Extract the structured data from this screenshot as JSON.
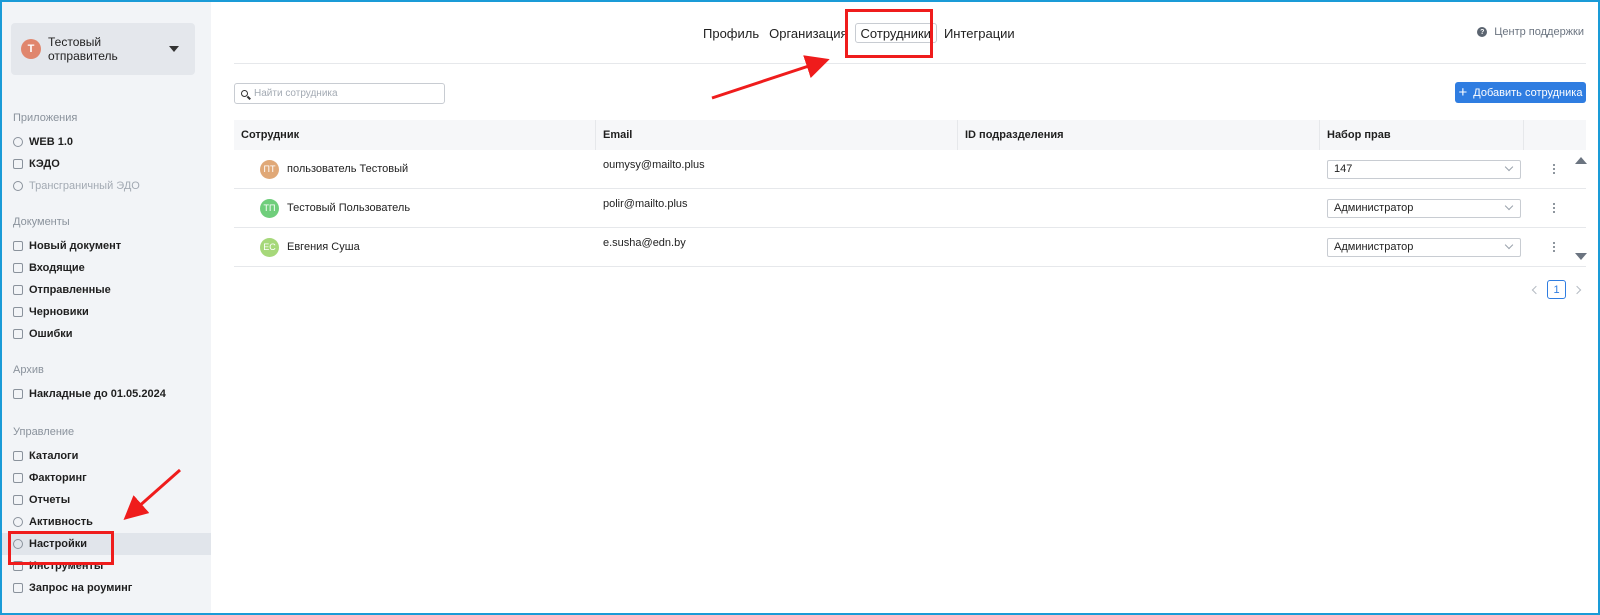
{
  "account": {
    "initial": "Т",
    "name": "Тестовый отправитель"
  },
  "sidebar": {
    "sections": [
      {
        "title": "Приложения",
        "items": [
          {
            "label": "WEB 1.0",
            "icon": "refresh-icon"
          },
          {
            "label": "КЭДО",
            "icon": "document-icon"
          },
          {
            "label": "Трансграничный ЭДО",
            "icon": "globe-icon",
            "disabled": true
          }
        ]
      },
      {
        "title": "Документы",
        "items": [
          {
            "label": "Новый документ",
            "icon": "new-document-icon"
          },
          {
            "label": "Входящие",
            "icon": "inbox-icon"
          },
          {
            "label": "Отправленные",
            "icon": "send-icon"
          },
          {
            "label": "Черновики",
            "icon": "draft-icon"
          },
          {
            "label": "Ошибки",
            "icon": "error-icon"
          }
        ]
      },
      {
        "title": "Архив",
        "items": [
          {
            "label": "Накладные до 01.05.2024",
            "icon": "archive-icon"
          }
        ]
      },
      {
        "title": "Управление",
        "items": [
          {
            "label": "Каталоги",
            "icon": "catalog-icon"
          },
          {
            "label": "Факторинг",
            "icon": "chart-icon"
          },
          {
            "label": "Отчеты",
            "icon": "report-icon"
          },
          {
            "label": "Активность",
            "icon": "activity-icon"
          },
          {
            "label": "Настройки",
            "icon": "gear-icon",
            "active": true
          },
          {
            "label": "Инструменты",
            "icon": "wrench-icon"
          },
          {
            "label": "Запрос на роуминг",
            "icon": "roaming-icon"
          }
        ]
      }
    ]
  },
  "tabs": [
    {
      "label": "Профиль"
    },
    {
      "label": "Организация"
    },
    {
      "label": "Сотрудники",
      "active": true
    },
    {
      "label": "Интеграции"
    }
  ],
  "help": {
    "label": "Центр поддержки"
  },
  "search": {
    "placeholder": "Найти сотрудника",
    "value": ""
  },
  "add_button": {
    "label": "Добавить сотрудника"
  },
  "table": {
    "columns": [
      "Сотрудник",
      "Email",
      "ID подразделения",
      "Набор прав"
    ],
    "rows": [
      {
        "initials": "ПТ",
        "avatar_color": "#e0a877",
        "name": "пользователь Тестовый",
        "email": "oumysy@mailto.plus",
        "department_id": "",
        "rights": "147"
      },
      {
        "initials": "ТП",
        "avatar_color": "#6fce7b",
        "name": "Тестовый Пользователь",
        "email": "polir@mailto.plus",
        "department_id": "",
        "rights": "Администратор"
      },
      {
        "initials": "ЕС",
        "avatar_color": "#a6d87a",
        "name": "Евгения Суша",
        "email": "e.susha@edn.by",
        "department_id": "",
        "rights": "Администратор"
      }
    ]
  },
  "pagination": {
    "current": "1"
  },
  "colors": {
    "accent": "#2f7de1",
    "highlight": "#ef1c1c",
    "frame": "#1a9bd7"
  }
}
